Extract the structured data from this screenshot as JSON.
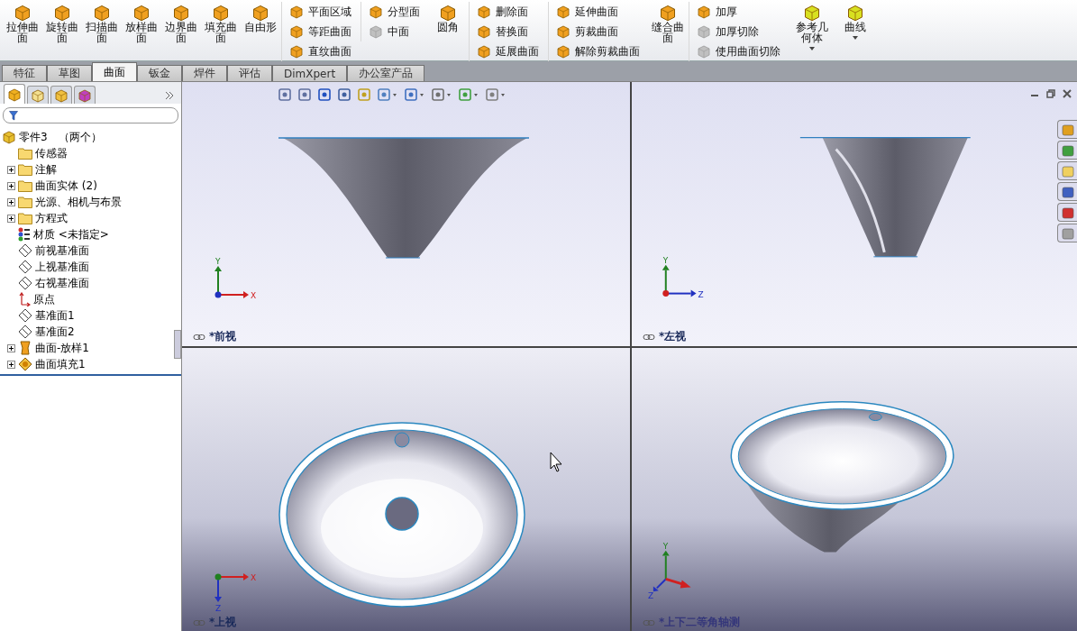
{
  "ribbon": [
    {
      "kind": "large",
      "label": "拉伸曲面",
      "disabled": false,
      "dropdown": false
    },
    {
      "kind": "large",
      "label": "旋转曲面",
      "disabled": false,
      "dropdown": false
    },
    {
      "kind": "large",
      "label": "扫描曲面",
      "disabled": false,
      "dropdown": false
    },
    {
      "kind": "large",
      "label": "放样曲面",
      "disabled": false,
      "dropdown": false
    },
    {
      "kind": "large",
      "label": "边界曲面",
      "disabled": false,
      "dropdown": false
    },
    {
      "kind": "large",
      "label": "填充曲面",
      "disabled": false,
      "dropdown": false
    },
    {
      "kind": "large",
      "label": "自由形",
      "disabled": false,
      "dropdown": false
    },
    {
      "kind": "stack",
      "items": [
        {
          "label": "平面区域",
          "disabled": false
        },
        {
          "label": "等距曲面",
          "disabled": false
        },
        {
          "label": "直纹曲面",
          "disabled": false
        }
      ]
    },
    {
      "kind": "stack",
      "items": [
        {
          "label": "分型面",
          "disabled": false
        },
        {
          "label": "中面",
          "disabled": true
        }
      ]
    },
    {
      "kind": "large",
      "label": "圆角",
      "disabled": false,
      "dropdown": false
    },
    {
      "kind": "stack",
      "items": [
        {
          "label": "删除面",
          "disabled": false
        },
        {
          "label": "替换面",
          "disabled": false
        },
        {
          "label": "延展曲面",
          "disabled": false
        }
      ]
    },
    {
      "kind": "stack",
      "items": [
        {
          "label": "延伸曲面",
          "disabled": false
        },
        {
          "label": "剪裁曲面",
          "disabled": false
        },
        {
          "label": "解除剪裁曲面",
          "disabled": false
        }
      ]
    },
    {
      "kind": "large",
      "label": "缝合曲面",
      "disabled": false,
      "dropdown": false
    },
    {
      "kind": "stack",
      "items": [
        {
          "label": "加厚",
          "disabled": false
        },
        {
          "label": "加厚切除",
          "disabled": true
        },
        {
          "label": "使用曲面切除",
          "disabled": true
        }
      ]
    },
    {
      "kind": "large",
      "label": "参考几何体",
      "disabled": false,
      "dropdown": true
    },
    {
      "kind": "large",
      "label": "曲线",
      "disabled": false,
      "dropdown": true
    }
  ],
  "tabs": [
    {
      "label": "特征",
      "selected": false
    },
    {
      "label": "草图",
      "selected": false
    },
    {
      "label": "曲面",
      "selected": true
    },
    {
      "label": "钣金",
      "selected": false
    },
    {
      "label": "焊件",
      "selected": false
    },
    {
      "label": "评估",
      "selected": false
    },
    {
      "label": "DimXpert",
      "selected": false
    },
    {
      "label": "办公室产品",
      "selected": false
    }
  ],
  "panel_tabs": [
    {
      "selected": true
    },
    {
      "selected": false
    },
    {
      "selected": false
    },
    {
      "selected": false
    }
  ],
  "tree": {
    "label": "零件3　（两个）",
    "children": [
      {
        "label": "传感器",
        "kind": "folder",
        "expandable": false
      },
      {
        "label": "注解",
        "kind": "folder",
        "expandable": true
      },
      {
        "label": "曲面实体 (2)",
        "kind": "folder",
        "expandable": true
      },
      {
        "label": "光源、相机与布景",
        "kind": "folder",
        "expandable": true
      },
      {
        "label": "方程式",
        "kind": "folder",
        "expandable": true
      },
      {
        "label": "材质 <未指定>",
        "kind": "material",
        "expandable": false
      },
      {
        "label": "前视基准面",
        "kind": "plane",
        "expandable": false
      },
      {
        "label": "上视基准面",
        "kind": "plane",
        "expandable": false
      },
      {
        "label": "右视基准面",
        "kind": "plane",
        "expandable": false
      },
      {
        "label": "原点",
        "kind": "origin",
        "expandable": false
      },
      {
        "label": "基准面1",
        "kind": "plane",
        "expandable": false
      },
      {
        "label": "基准面2",
        "kind": "plane",
        "expandable": false
      },
      {
        "label": "曲面-放样1",
        "kind": "loft",
        "expandable": true
      },
      {
        "label": "曲面填充1",
        "kind": "fill",
        "expandable": true
      }
    ]
  },
  "viewports": [
    {
      "kind": "front",
      "label": "*前视",
      "axes": [
        {
          "label": "Y"
        },
        {
          "label": "X"
        }
      ]
    },
    {
      "kind": "left",
      "label": "*左视",
      "axes": [
        {
          "label": "Y"
        },
        {
          "label": "Z"
        }
      ]
    },
    {
      "kind": "top",
      "label": "*上视",
      "axes": [
        {
          "label": "X"
        },
        {
          "label": "Z"
        }
      ]
    },
    {
      "kind": "iso",
      "label": "*上下二等角轴测",
      "axes": [
        {
          "label": "Y"
        },
        {
          "label": "Z"
        }
      ]
    }
  ]
}
